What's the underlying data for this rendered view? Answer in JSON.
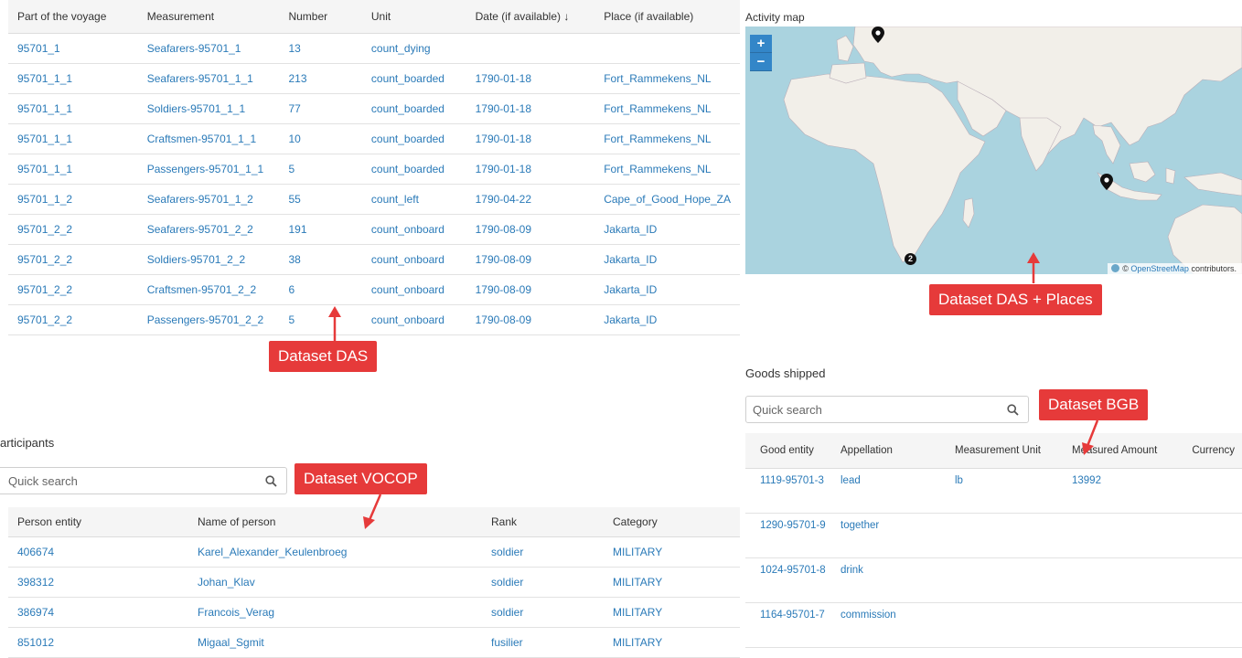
{
  "das": {
    "columns": [
      "Part of the voyage",
      "Measurement",
      "Number",
      "Unit",
      "Date (if available)",
      "Place (if available)"
    ],
    "sort_indicator": "↓",
    "rows": [
      [
        "95701_1",
        "Seafarers-95701_1",
        "13",
        "count_dying",
        "",
        ""
      ],
      [
        "95701_1_1",
        "Seafarers-95701_1_1",
        "213",
        "count_boarded",
        "1790-01-18",
        "Fort_Rammekens_NL"
      ],
      [
        "95701_1_1",
        "Soldiers-95701_1_1",
        "77",
        "count_boarded",
        "1790-01-18",
        "Fort_Rammekens_NL"
      ],
      [
        "95701_1_1",
        "Craftsmen-95701_1_1",
        "10",
        "count_boarded",
        "1790-01-18",
        "Fort_Rammekens_NL"
      ],
      [
        "95701_1_1",
        "Passengers-95701_1_1",
        "5",
        "count_boarded",
        "1790-01-18",
        "Fort_Rammekens_NL"
      ],
      [
        "95701_1_2",
        "Seafarers-95701_1_2",
        "55",
        "count_left",
        "1790-04-22",
        "Cape_of_Good_Hope_ZA"
      ],
      [
        "95701_2_2",
        "Seafarers-95701_2_2",
        "191",
        "count_onboard",
        "1790-08-09",
        "Jakarta_ID"
      ],
      [
        "95701_2_2",
        "Soldiers-95701_2_2",
        "38",
        "count_onboard",
        "1790-08-09",
        "Jakarta_ID"
      ],
      [
        "95701_2_2",
        "Craftsmen-95701_2_2",
        "6",
        "count_onboard",
        "1790-08-09",
        "Jakarta_ID"
      ],
      [
        "95701_2_2",
        "Passengers-95701_2_2",
        "5",
        "count_onboard",
        "1790-08-09",
        "Jakarta_ID"
      ]
    ]
  },
  "map": {
    "title": "Activity map",
    "zoom_in": "+",
    "zoom_out": "−",
    "cluster_count": "2",
    "attribution_prefix": "©",
    "attribution_link": "OpenStreetMap",
    "attribution_suffix": "contributors."
  },
  "callouts": {
    "das": "Dataset DAS",
    "das_places": "Dataset DAS + Places",
    "bgb": "Dataset BGB",
    "vocop": "Dataset VOCOP",
    "color": "#e63a3a"
  },
  "goods": {
    "title": "Goods shipped",
    "search_placeholder": "Quick search",
    "columns": [
      "Good entity",
      "Appellation",
      "Measurement Unit",
      "Measured Amount",
      "Currency"
    ],
    "rows": [
      [
        "1119-95701-3",
        "lead",
        "lb",
        "13992",
        ""
      ],
      [
        "1290-95701-9",
        "together",
        "",
        "",
        ""
      ],
      [
        "1024-95701-8",
        "drink",
        "",
        "",
        ""
      ],
      [
        "1164-95701-7",
        "commission",
        "",
        "",
        ""
      ]
    ]
  },
  "participants": {
    "title": "articipants",
    "search_placeholder": "Quick search",
    "columns": [
      "Person entity",
      "Name of person",
      "Rank",
      "Category"
    ],
    "rows": [
      [
        "406674",
        "Karel_Alexander_Keulenbroeg",
        "soldier",
        "MILITARY"
      ],
      [
        "398312",
        "Johan_Klav",
        "soldier",
        "MILITARY"
      ],
      [
        "386974",
        "Francois_Verag",
        "soldier",
        "MILITARY"
      ],
      [
        "851012",
        "Migaal_Sgmit",
        "fusilier",
        "MILITARY"
      ]
    ]
  }
}
